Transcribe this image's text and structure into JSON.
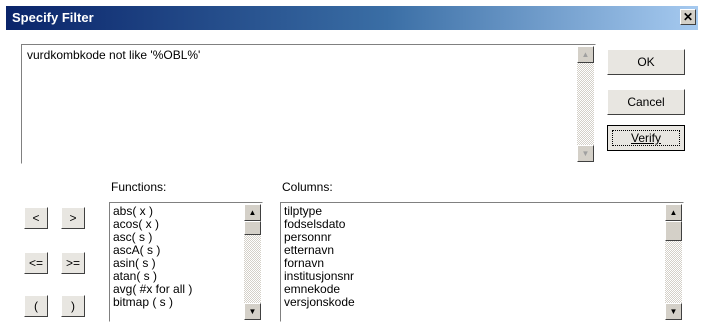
{
  "window": {
    "title": "Specify Filter",
    "close_glyph": "✕"
  },
  "filter": {
    "expression": "vurdkombkode not like '%OBL%'"
  },
  "buttons": {
    "ok": "OK",
    "cancel": "Cancel",
    "verify": "Verify"
  },
  "operators": {
    "lt": "<",
    "gt": ">",
    "le": "<=",
    "ge": ">=",
    "lparen": "(",
    "rparen": ")"
  },
  "functions": {
    "label": "Functions:",
    "items": [
      "abs( x )",
      "acos( x )",
      "asc( s )",
      "ascA( s )",
      "asin( s )",
      "atan( s )",
      "avg( #x for all )",
      "bitmap ( s )"
    ]
  },
  "columns": {
    "label": "Columns:",
    "items": [
      "tilptype",
      "fodselsdato",
      "personnr",
      "etternavn",
      "fornavn",
      "institusjonsnr",
      "emnekode",
      "versjonskode"
    ]
  },
  "icons": {
    "scroll_up": "▲",
    "scroll_down": "▼"
  }
}
